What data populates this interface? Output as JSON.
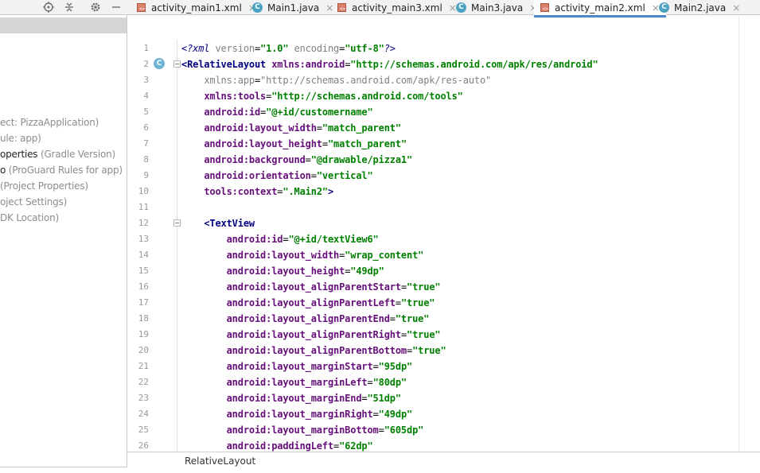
{
  "left_panel": {
    "toolbar_icons": [
      "locate-icon",
      "collapse-icon",
      "gear-icon",
      "minimize-icon"
    ],
    "items": [
      {
        "dark": "",
        "gray": "ect: PizzaApplication)"
      },
      {
        "dark": "",
        "gray": "ule: app)"
      },
      {
        "dark": "operties",
        "gray": " (Gradle Version)"
      },
      {
        "dark": "o",
        "gray": " (ProGuard Rules for app)"
      },
      {
        "dark": "",
        "gray": "(Project Properties)"
      },
      {
        "dark": "",
        "gray": "oject Settings)"
      },
      {
        "dark": "",
        "gray": "DK Location)"
      }
    ]
  },
  "tabs": [
    {
      "label": "activity_main1.xml",
      "type": "xml",
      "active": false
    },
    {
      "label": "Main1.java",
      "type": "java",
      "active": false
    },
    {
      "label": "activity_main3.xml",
      "type": "xml",
      "active": false
    },
    {
      "label": "Main3.java",
      "type": "java",
      "active": false
    },
    {
      "label": "activity_main2.xml",
      "type": "xml",
      "active": true
    },
    {
      "label": "Main2.java",
      "type": "java",
      "active": false
    }
  ],
  "tab_close_glyph": "×",
  "java_icon_letter": "C",
  "xml_icon_letters": "<>",
  "editor": {
    "lines": [
      {
        "n": "1",
        "parts": [
          [
            "pi",
            "<?xml "
          ],
          [
            "attr-gray",
            "version"
          ],
          [
            "plain",
            "="
          ],
          [
            "val",
            "\"1.0\""
          ],
          [
            "plain",
            " "
          ],
          [
            "attr-gray",
            "encoding"
          ],
          [
            "plain",
            "="
          ],
          [
            "val",
            "\"utf-8\""
          ],
          [
            "pi",
            "?>"
          ]
        ]
      },
      {
        "n": "2",
        "parts": [
          [
            "tag",
            "<RelativeLayout "
          ],
          [
            "attr",
            "xmlns:android"
          ],
          [
            "plain",
            "="
          ],
          [
            "val",
            "\"http://schemas.android.com/apk/res/android\""
          ]
        ]
      },
      {
        "n": "3",
        "parts": [
          [
            "plain",
            "    "
          ],
          [
            "attr-gray",
            "xmlns:app"
          ],
          [
            "plain",
            "="
          ],
          [
            "attr-gray",
            "\"http://schemas.android.com/apk/res-auto\""
          ]
        ]
      },
      {
        "n": "4",
        "parts": [
          [
            "plain",
            "    "
          ],
          [
            "attr",
            "xmlns:tools"
          ],
          [
            "plain",
            "="
          ],
          [
            "val",
            "\"http://schemas.android.com/tools\""
          ]
        ]
      },
      {
        "n": "5",
        "parts": [
          [
            "plain",
            "    "
          ],
          [
            "attr",
            "android:id"
          ],
          [
            "plain",
            "="
          ],
          [
            "val",
            "\"@+id/customername\""
          ]
        ]
      },
      {
        "n": "6",
        "parts": [
          [
            "plain",
            "    "
          ],
          [
            "attr",
            "android:layout_width"
          ],
          [
            "plain",
            "="
          ],
          [
            "val",
            "\"match_parent\""
          ]
        ]
      },
      {
        "n": "7",
        "parts": [
          [
            "plain",
            "    "
          ],
          [
            "attr",
            "android:layout_height"
          ],
          [
            "plain",
            "="
          ],
          [
            "val",
            "\"match_parent\""
          ]
        ]
      },
      {
        "n": "8",
        "parts": [
          [
            "plain",
            "    "
          ],
          [
            "attr",
            "android:background"
          ],
          [
            "plain",
            "="
          ],
          [
            "val",
            "\"@drawable/pizza1\""
          ]
        ]
      },
      {
        "n": "9",
        "parts": [
          [
            "plain",
            "    "
          ],
          [
            "attr",
            "android:orientation"
          ],
          [
            "plain",
            "="
          ],
          [
            "val",
            "\"vertical\""
          ]
        ]
      },
      {
        "n": "10",
        "parts": [
          [
            "plain",
            "    "
          ],
          [
            "attr",
            "tools:context"
          ],
          [
            "plain",
            "="
          ],
          [
            "val",
            "\".Main2\""
          ],
          [
            "tag",
            ">"
          ]
        ]
      },
      {
        "n": "11",
        "parts": []
      },
      {
        "n": "12",
        "parts": [
          [
            "plain",
            "    "
          ],
          [
            "tag",
            "<TextView"
          ]
        ]
      },
      {
        "n": "13",
        "parts": [
          [
            "plain",
            "        "
          ],
          [
            "attr",
            "android:id"
          ],
          [
            "plain",
            "="
          ],
          [
            "val",
            "\"@+id/textView6\""
          ]
        ]
      },
      {
        "n": "14",
        "parts": [
          [
            "plain",
            "        "
          ],
          [
            "attr",
            "android:layout_width"
          ],
          [
            "plain",
            "="
          ],
          [
            "val",
            "\"wrap_content\""
          ]
        ]
      },
      {
        "n": "15",
        "parts": [
          [
            "plain",
            "        "
          ],
          [
            "attr",
            "android:layout_height"
          ],
          [
            "plain",
            "="
          ],
          [
            "val",
            "\"49dp\""
          ]
        ]
      },
      {
        "n": "16",
        "parts": [
          [
            "plain",
            "        "
          ],
          [
            "attr",
            "android:layout_alignParentStart"
          ],
          [
            "plain",
            "="
          ],
          [
            "val",
            "\"true\""
          ]
        ]
      },
      {
        "n": "17",
        "parts": [
          [
            "plain",
            "        "
          ],
          [
            "attr",
            "android:layout_alignParentLeft"
          ],
          [
            "plain",
            "="
          ],
          [
            "val",
            "\"true\""
          ]
        ]
      },
      {
        "n": "18",
        "parts": [
          [
            "plain",
            "        "
          ],
          [
            "attr",
            "android:layout_alignParentEnd"
          ],
          [
            "plain",
            "="
          ],
          [
            "val",
            "\"true\""
          ]
        ]
      },
      {
        "n": "19",
        "parts": [
          [
            "plain",
            "        "
          ],
          [
            "attr",
            "android:layout_alignParentRight"
          ],
          [
            "plain",
            "="
          ],
          [
            "val",
            "\"true\""
          ]
        ]
      },
      {
        "n": "20",
        "parts": [
          [
            "plain",
            "        "
          ],
          [
            "attr",
            "android:layout_alignParentBottom"
          ],
          [
            "plain",
            "="
          ],
          [
            "val",
            "\"true\""
          ]
        ]
      },
      {
        "n": "21",
        "parts": [
          [
            "plain",
            "        "
          ],
          [
            "attr",
            "android:layout_marginStart"
          ],
          [
            "plain",
            "="
          ],
          [
            "val",
            "\"95dp\""
          ]
        ]
      },
      {
        "n": "22",
        "parts": [
          [
            "plain",
            "        "
          ],
          [
            "attr",
            "android:layout_marginLeft"
          ],
          [
            "plain",
            "="
          ],
          [
            "val",
            "\"80dp\""
          ]
        ]
      },
      {
        "n": "23",
        "parts": [
          [
            "plain",
            "        "
          ],
          [
            "attr",
            "android:layout_marginEnd"
          ],
          [
            "plain",
            "="
          ],
          [
            "val",
            "\"51dp\""
          ]
        ]
      },
      {
        "n": "24",
        "parts": [
          [
            "plain",
            "        "
          ],
          [
            "attr",
            "android:layout_marginRight"
          ],
          [
            "plain",
            "="
          ],
          [
            "val",
            "\"49dp\""
          ]
        ]
      },
      {
        "n": "25",
        "parts": [
          [
            "plain",
            "        "
          ],
          [
            "attr",
            "android:layout_marginBottom"
          ],
          [
            "plain",
            "="
          ],
          [
            "val",
            "\"605dp\""
          ]
        ]
      },
      {
        "n": "26",
        "parts": [
          [
            "plain",
            "        "
          ],
          [
            "attr",
            "android:paddingLeft"
          ],
          [
            "plain",
            "="
          ],
          [
            "val",
            "\"62dp\""
          ]
        ]
      }
    ]
  },
  "breadcrumb": "RelativeLayout",
  "colors": {
    "accent": "#4a88c7",
    "tag": "#000080",
    "attribute": "#660e7a",
    "value": "#008000"
  }
}
